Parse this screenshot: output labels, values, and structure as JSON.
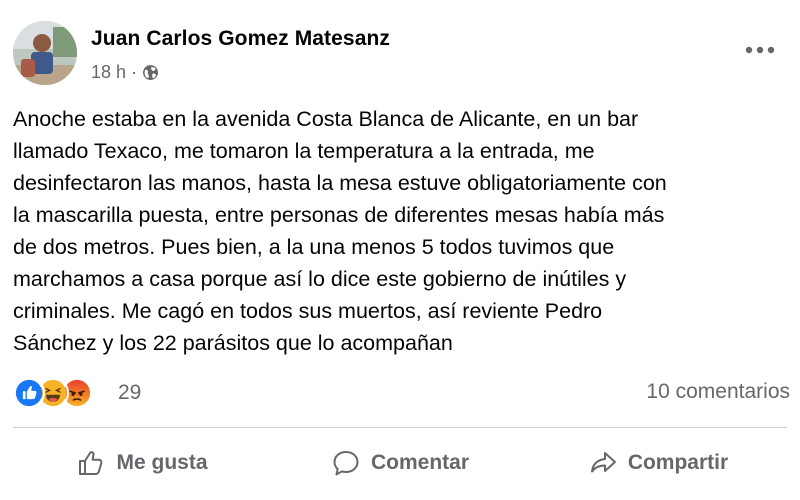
{
  "post": {
    "author": "Juan Carlos Gomez Matesanz",
    "time": "18 h",
    "separator": "·",
    "privacy_icon": "globe-icon",
    "menu_icon": "more-options-icon",
    "text": "Anoche estaba en la avenida Costa Blanca de Alicante,  en un bar\nllamado Texaco,  me tomaron la temperatura a la entrada, me\ndesinfectaron las manos, hasta la mesa estuve obligatoriamente con\nla mascarilla puesta, entre personas de diferentes mesas había más\nde dos metros. Pues bien, a la una menos 5 todos tuvimos  que\nmarchamos a casa porque así lo dice este gobierno de inútiles y\ncriminales. Me cagó en todos sus muertos, así reviente Pedro\nSánchez  y los 22 parásitos que lo acompañan"
  },
  "reactions": {
    "icons": [
      "like-reaction-icon",
      "haha-reaction-icon",
      "angry-reaction-icon"
    ],
    "count": "29"
  },
  "comments": {
    "label": "10 comentarios"
  },
  "actions": {
    "like_label": "Me gusta",
    "comment_label": "Comentar",
    "share_label": "Compartir"
  },
  "colors": {
    "text": "#050505",
    "secondary": "#65676b",
    "like_blue": "#1877f2",
    "haha_yellow": "#f7b125",
    "angry_orange": "#e9710f",
    "divider": "#ced0d4"
  }
}
